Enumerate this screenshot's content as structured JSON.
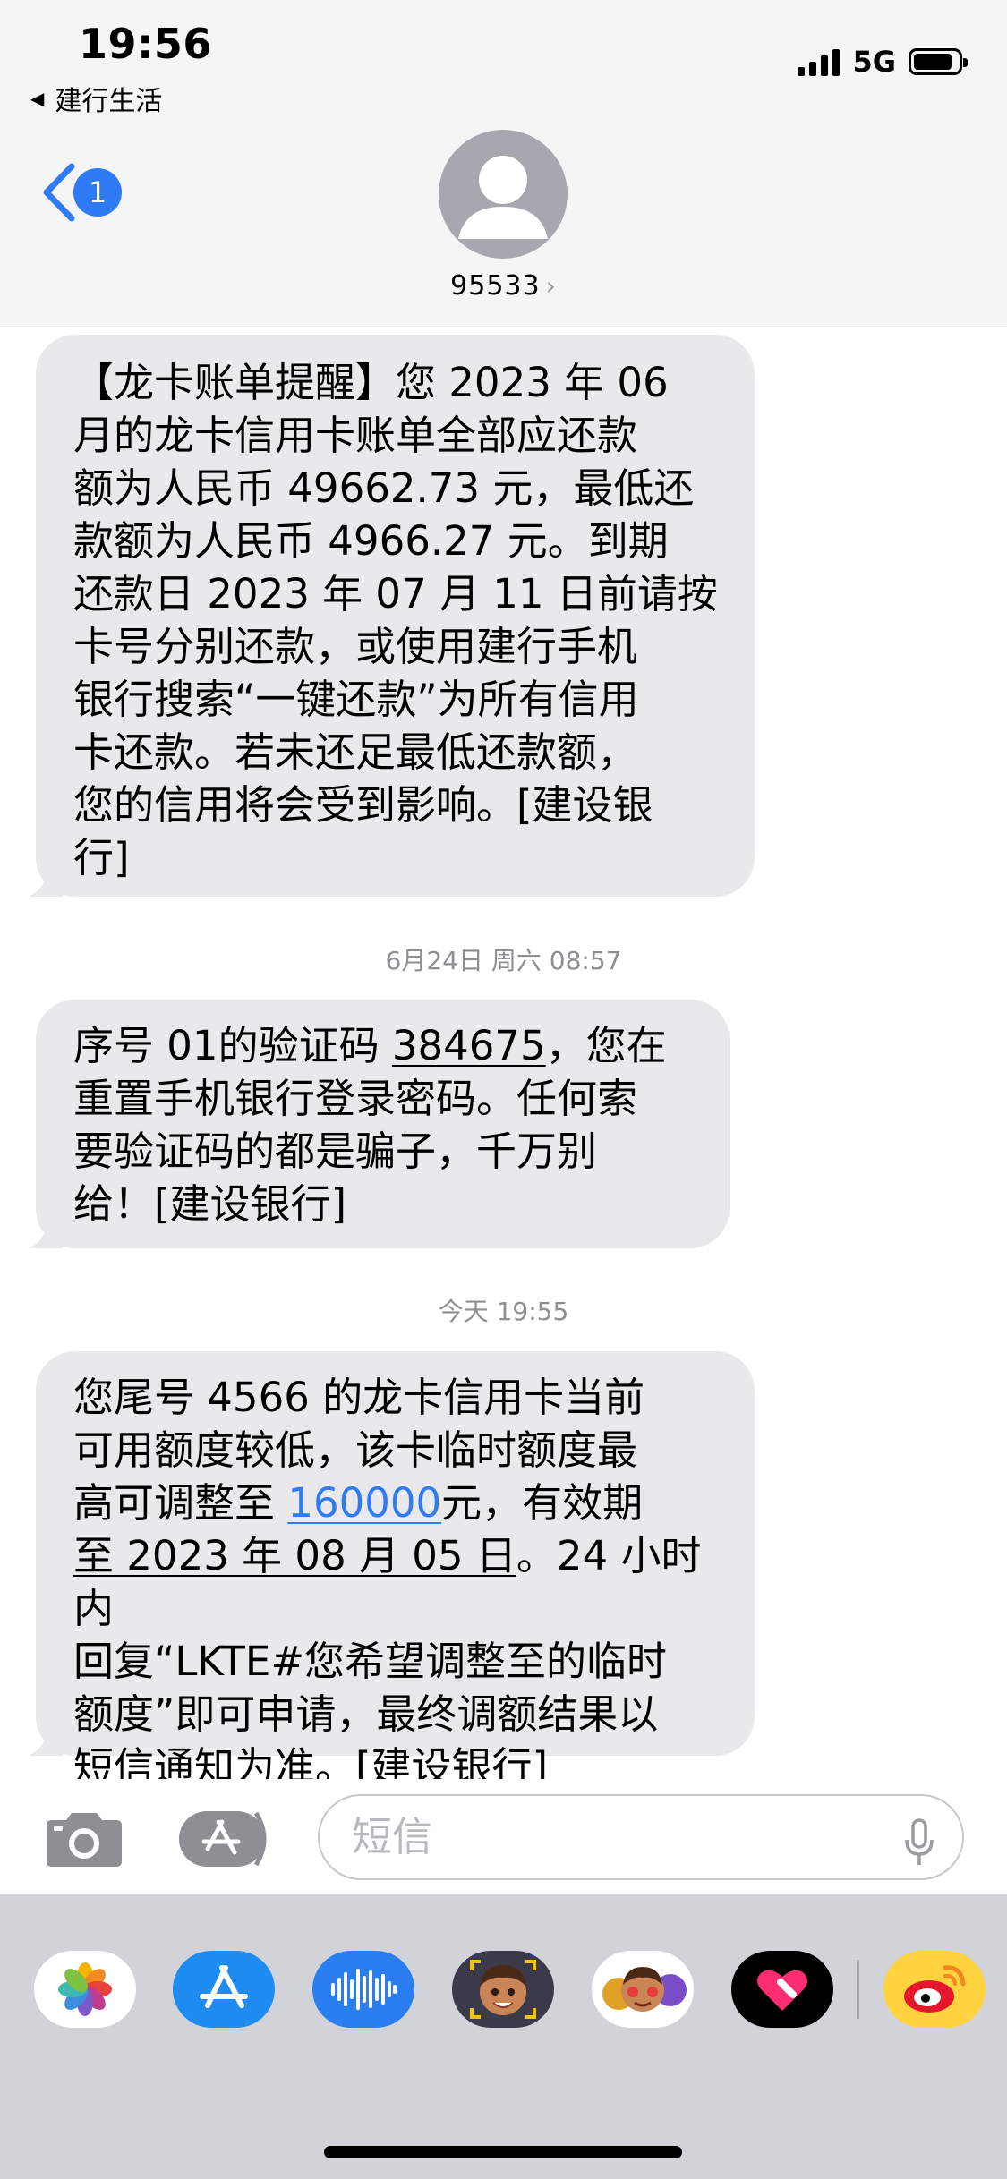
{
  "status_bar": {
    "time": "19:56",
    "back_app": "建行生活",
    "network": "5G"
  },
  "nav": {
    "unread_count": "1",
    "contact": "95533"
  },
  "messages": [
    {
      "type": "incoming",
      "lines": [
        "【龙卡账单提醒】您 2023 年 06",
        "月的龙卡信用卡账单全部应还款",
        "额为人民币 49662.73 元，最低还",
        "款额为人民币 4966.27 元。到期",
        "还款日 2023 年 07 月 11 日前请按",
        "卡号分别还款，或使用建行手机",
        "银行搜索“一键还款”为所有信用",
        "卡还款。若未还足最低还款额，",
        "您的信用将会受到影响。[建设银",
        "行]"
      ]
    },
    {
      "type": "timestamp",
      "text": "6月24日 周六 08:57"
    },
    {
      "type": "incoming",
      "line1_pre": "序号 01的验证码 ",
      "code": "384675",
      "line1_post": "，您在",
      "lines": [
        "重置手机银行登录密码。任何索",
        "要验证码的都是骗子，千万别",
        "给！[建设银行]"
      ]
    },
    {
      "type": "timestamp",
      "text": "今天 19:55"
    },
    {
      "type": "incoming",
      "line1": "您尾号 4566 的龙卡信用卡当前",
      "line2": "可用额度较低，该卡临时额度最",
      "line3_pre": "高可调整至 ",
      "amount_link": "160000",
      "line3_post": "元，有效期",
      "date_link": "至 2023 年 08 月 05 日",
      "line4_post": "。24 小时内",
      "lines": [
        "回复“LKTE#您希望调整至的临时",
        "额度”即可申请，最终调额结果以",
        "短信通知为准。[建设银行]"
      ]
    }
  ],
  "input": {
    "placeholder": "短信"
  },
  "app_drawer": {
    "apps": [
      "photos-app",
      "app-store-app",
      "audio-message-app",
      "memoji-app",
      "animoji-stickers-app",
      "digital-touch-app",
      "weibo-app"
    ]
  },
  "colors": {
    "accent": "#2f7bf5",
    "bubble": "#e9e9eb",
    "drawer": "#d1d3d9"
  }
}
